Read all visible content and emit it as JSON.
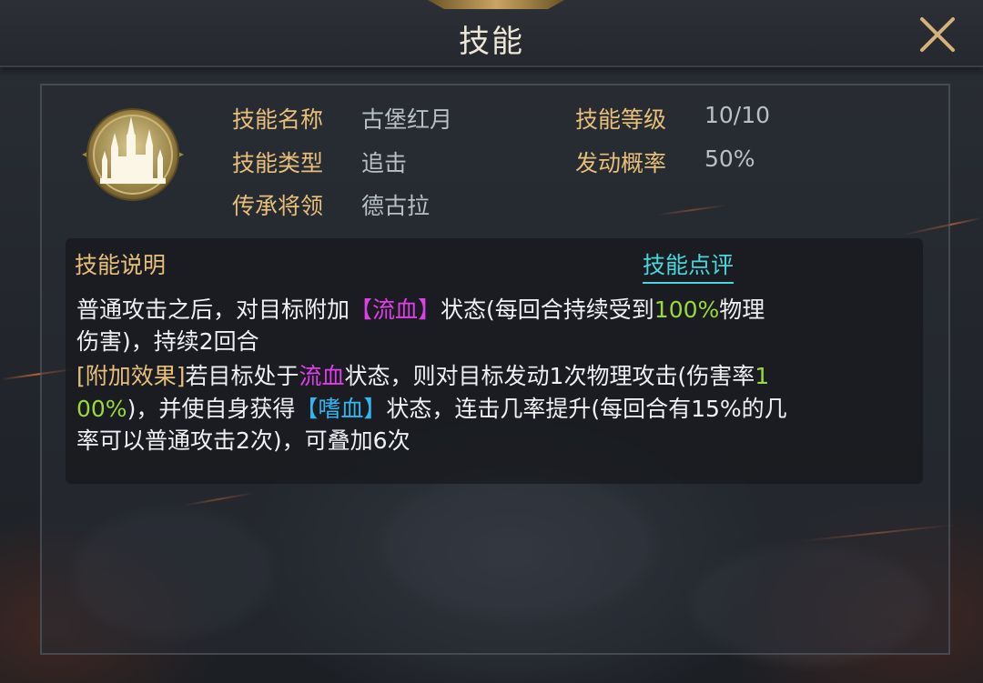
{
  "header": {
    "title": "技能"
  },
  "skill": {
    "icon": "castle-moon-icon",
    "name_label": "技能名称",
    "name_value": "古堡红月",
    "level_label": "技能等级",
    "level_value": "10/10",
    "type_label": "技能类型",
    "type_value": "追击",
    "chance_label": "发动概率",
    "chance_value": "50%",
    "inherit_label": "传承将领",
    "inherit_value": "德古拉"
  },
  "description": {
    "heading": "技能说明",
    "review_link": "技能点评",
    "line1": {
      "a": "普通攻击之后，对目标附加",
      "status": "【流血】",
      "b": "状态(每回合持续受到",
      "pct": "100%",
      "c": "物理"
    },
    "line2": "伤害)，持续2回合",
    "line3": {
      "tag": "[附加效果]",
      "a": "若目标处于",
      "status": "流血",
      "b": "状态，则对目标发动1次物理攻击(伤害率",
      "pct": "1"
    },
    "line4": {
      "pct": "00%",
      "a": ")，并使自身获得",
      "status": "【嗜血】",
      "b": "状态，连击几率提升(每回合有15%的几"
    },
    "line5": "率可以普通攻击2次)，可叠加6次"
  },
  "colors": {
    "label_gold": "#e7bf79",
    "value_gray": "#b9bfc8",
    "link_cyan": "#47d8dc",
    "bleed_magenta": "#e03ee9",
    "percent_green": "#9ad93b",
    "bloodlust_blue": "#2fb8f0"
  }
}
